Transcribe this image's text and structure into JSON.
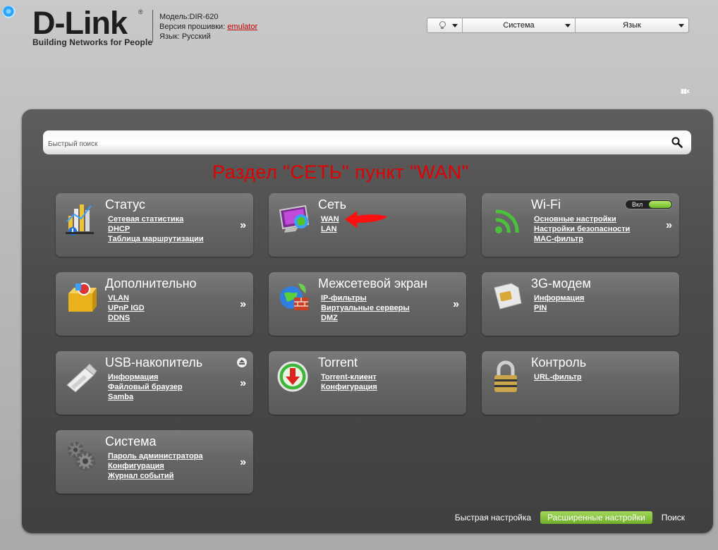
{
  "header": {
    "logo_text": "D-Link",
    "logo_reg": "®",
    "logo_tagline": "Building Networks for People",
    "model_label": "Модель:",
    "model_value": "DIR-620",
    "firmware_label": "Версия прошивки:",
    "firmware_value": "emulator",
    "language_label": "Язык:",
    "language_value": "Русский"
  },
  "topbar": {
    "help_icon": "lightbulb-icon",
    "system_label": "Система",
    "language_label": "Язык"
  },
  "layout_toggle_text": "▮▮x",
  "search": {
    "placeholder": "Быстрый поиск",
    "icon": "magnifier-icon"
  },
  "annotation": "Раздел \"СЕТЬ\" пункт \"WAN\"",
  "tiles": {
    "status": {
      "title": "Статус",
      "links": [
        "Сетевая статистика",
        "DHCP",
        "Таблица маршрутизации"
      ],
      "more": "»"
    },
    "network": {
      "title": "Сеть",
      "links": [
        "WAN",
        "LAN"
      ]
    },
    "wifi": {
      "title": "Wi-Fi",
      "links": [
        "Основные настройки",
        "Настройки безопасности",
        "MAC-фильтр"
      ],
      "more": "»",
      "toggle_label": "Вкл",
      "toggle_on": true
    },
    "advanced": {
      "title": "Дополнительно",
      "links": [
        "VLAN",
        "UPnP IGD",
        "DDNS"
      ],
      "more": "»"
    },
    "firewall": {
      "title": "Межсетевой экран",
      "links": [
        "IP-фильтры",
        "Виртуальные серверы",
        "DMZ"
      ],
      "more": "»"
    },
    "modem": {
      "title": "3G-модем",
      "links": [
        "Информация",
        "PIN"
      ]
    },
    "usb": {
      "title": "USB-накопитель",
      "links": [
        "Информация",
        "Файловый браузер",
        "Samba"
      ],
      "more": "»"
    },
    "torrent": {
      "title": "Torrent",
      "links": [
        "Torrent-клиент",
        "Конфигурация"
      ]
    },
    "control": {
      "title": "Контроль",
      "links": [
        "URL-фильтр"
      ]
    },
    "system": {
      "title": "Система",
      "links": [
        "Пароль администратора",
        "Конфигурация",
        "Журнал событий"
      ],
      "more": "»"
    }
  },
  "footer": {
    "quick_setup": "Быстрая настройка",
    "advanced_settings": "Расширенные настройки",
    "search": "Поиск"
  },
  "colors": {
    "accent_green": "#7dbf35",
    "annotation_red": "#e00000",
    "panel_bg": "#4c4c4c"
  }
}
